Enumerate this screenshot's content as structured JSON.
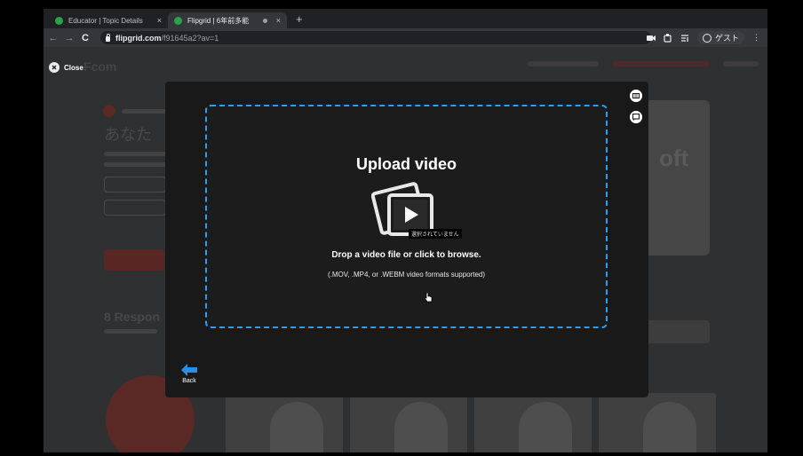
{
  "browser": {
    "tabs": [
      {
        "title": "Educator | Topic Details",
        "close": "×"
      },
      {
        "title": "Flipgrid | 6年前多能",
        "close": "×"
      }
    ],
    "new_tab": "+",
    "nav": {
      "back": "←",
      "forward": "→",
      "reload": "C"
    },
    "url_host": "flipgrid.com",
    "url_path": "/f91645a2?av=1",
    "profile_label": "ゲスト",
    "menu": "⋮"
  },
  "page": {
    "close_label": "Close",
    "brand": "Fcom",
    "heading": "あなた",
    "responses_label": "8 Respon",
    "card_text": "oft"
  },
  "modal": {
    "title": "Upload video",
    "file_status": "選択されていません",
    "drop_text": "Drop a video file or click to browse.",
    "formats_text": "(.MOV, .MP4, or .WEBM video formats supported)",
    "back_label": "Back"
  },
  "colors": {
    "accent_blue": "#2a9df4",
    "favicon_green": "#2aa14a",
    "modal_bg": "#191919"
  }
}
